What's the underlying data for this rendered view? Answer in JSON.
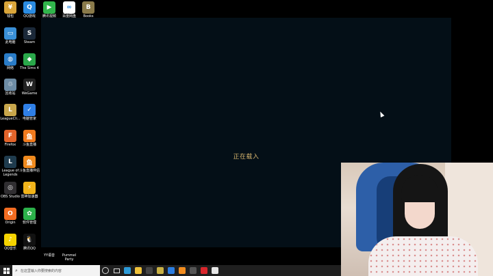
{
  "desktop": {
    "icons": [
      {
        "label": "钱包",
        "color": "#d9a53a",
        "glyph": "¥"
      },
      {
        "label": "QQ游戏",
        "color": "#2b8be0",
        "glyph": "Q"
      },
      {
        "label": "腾讯视频",
        "color": "#31b54b",
        "glyph": "▶"
      },
      {
        "label": "百度网盘",
        "color": "#ffffff",
        "glyph": "∞"
      },
      {
        "label": "Books",
        "color": "#8a7a4a",
        "glyph": "B"
      },
      {
        "label": "此电脑",
        "color": "#3a8fd6",
        "glyph": "▭"
      },
      {
        "label": "Steam",
        "color": "#1b2838",
        "glyph": "S"
      },
      {
        "label": "网络",
        "color": "#2a7cc7",
        "glyph": "◍"
      },
      {
        "label": "The Sims 4",
        "color": "#2aa84a",
        "glyph": "◆"
      },
      {
        "label": "回收站",
        "color": "#6d8ca5",
        "glyph": "♲"
      },
      {
        "label": "WeGame",
        "color": "#222222",
        "glyph": "W"
      },
      {
        "label": "LeagueCli...",
        "color": "#c8a64b",
        "glyph": "L"
      },
      {
        "label": "电脑管家",
        "color": "#2f7fe6",
        "glyph": "✓"
      },
      {
        "label": "Firefox",
        "color": "#e2632a",
        "glyph": "F"
      },
      {
        "label": "斗鱼直播",
        "color": "#f07a1e",
        "glyph": "鱼"
      },
      {
        "label": "League of Legends",
        "color": "#1f3b4d",
        "glyph": "L"
      },
      {
        "label": "斗鱼直播伴侣",
        "color": "#f08a1e",
        "glyph": "鱼"
      },
      {
        "label": "OBS Studio",
        "color": "#302e31",
        "glyph": "◎"
      },
      {
        "label": "雷神加速器",
        "color": "#f2b41a",
        "glyph": "⚡"
      },
      {
        "label": "Origin",
        "color": "#f36c21",
        "glyph": "O"
      },
      {
        "label": "软件管理",
        "color": "#2cb14a",
        "glyph": "✿"
      },
      {
        "label": "QQ音乐",
        "color": "#f5d300",
        "glyph": "♪"
      },
      {
        "label": "腾讯QQ",
        "color": "#111111",
        "glyph": "🐧"
      },
      {
        "label": "YY语音",
        "color": "#000000",
        "glyph": ""
      },
      {
        "label": "Pummel Party",
        "color": "#000000",
        "glyph": ""
      }
    ]
  },
  "game": {
    "loading_text": "正在载入"
  },
  "taskbar": {
    "search_placeholder": "在这里输入你要搜索的内容",
    "apps": [
      {
        "name": "edge",
        "color": "#2c9ad7"
      },
      {
        "name": "explorer",
        "color": "#f0c23a"
      },
      {
        "name": "app-dark",
        "color": "#444444"
      },
      {
        "name": "wegame",
        "color": "#c9b144"
      },
      {
        "name": "store",
        "color": "#2b7de1"
      },
      {
        "name": "orange-app",
        "color": "#f28c1e"
      },
      {
        "name": "obs",
        "color": "#555555"
      },
      {
        "name": "netease-music",
        "color": "#d9262c"
      },
      {
        "name": "steam-tb",
        "color": "#e6e6e6"
      }
    ]
  }
}
